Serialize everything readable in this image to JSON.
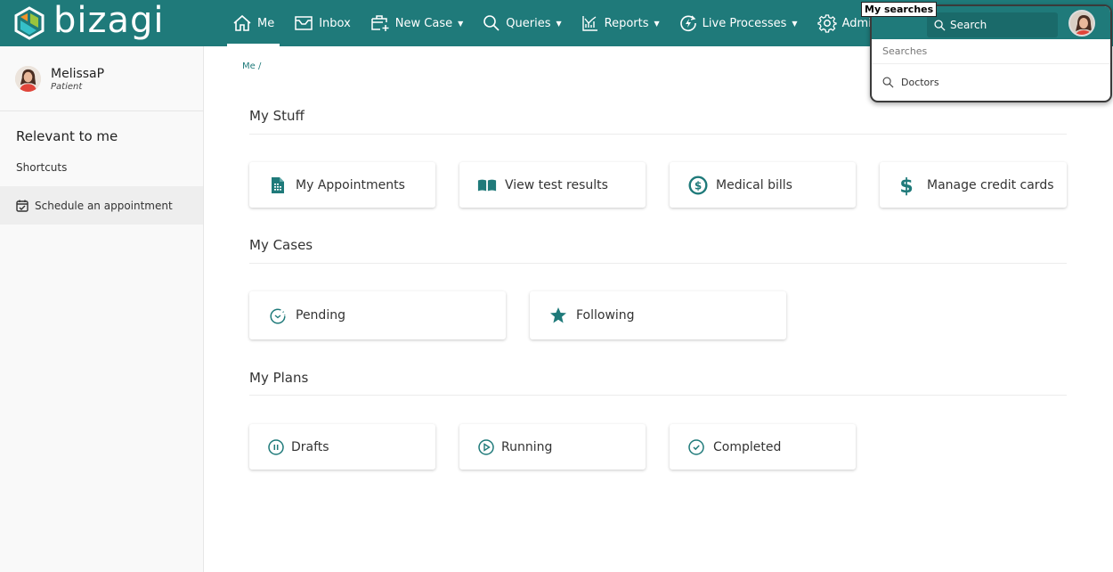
{
  "app": {
    "brand": "bizagi",
    "accent_color": "#1f7a7a"
  },
  "nav": {
    "items": [
      {
        "label": "Me",
        "icon": "home-icon",
        "active": true,
        "dropdown": false
      },
      {
        "label": "Inbox",
        "icon": "inbox-icon",
        "active": false,
        "dropdown": false
      },
      {
        "label": "New Case",
        "icon": "new-case-icon",
        "active": false,
        "dropdown": true
      },
      {
        "label": "Queries",
        "icon": "search-icon",
        "active": false,
        "dropdown": true
      },
      {
        "label": "Reports",
        "icon": "reports-icon",
        "active": false,
        "dropdown": true
      },
      {
        "label": "Live Processes",
        "icon": "live-processes-icon",
        "active": false,
        "dropdown": true
      },
      {
        "label": "Admin",
        "icon": "gear-icon",
        "active": false,
        "dropdown": true
      }
    ],
    "caret": "▼"
  },
  "search": {
    "tooltip": "My searches",
    "placeholder": "Search",
    "section_label": "Searches",
    "items": [
      {
        "label": "Doctors"
      }
    ]
  },
  "sidebar": {
    "user_name": "MelissaP",
    "user_role": "Patient",
    "title": "Relevant to me",
    "shortcuts_label": "Shortcuts",
    "shortcuts": [
      {
        "label": "Schedule an appointment",
        "icon": "calendar-check-icon"
      }
    ]
  },
  "main": {
    "breadcrumb": "Me /",
    "sections": [
      {
        "title": "My Stuff",
        "cards": [
          {
            "label": "My Appointments",
            "icon": "document-icon"
          },
          {
            "label": "View test results",
            "icon": "book-icon"
          },
          {
            "label": "Medical bills",
            "icon": "dollar-circle-icon"
          },
          {
            "label": "Manage credit cards",
            "icon": "dollar-icon"
          }
        ]
      },
      {
        "title": "My Cases",
        "cards": [
          {
            "label": "Pending",
            "icon": "timer-icon"
          },
          {
            "label": "Following",
            "icon": "star-icon"
          }
        ]
      },
      {
        "title": "My Plans",
        "cards": [
          {
            "label": "Drafts",
            "icon": "pause-circle-icon"
          },
          {
            "label": "Running",
            "icon": "play-circle-icon"
          },
          {
            "label": "Completed",
            "icon": "check-circle-icon"
          }
        ]
      }
    ]
  }
}
